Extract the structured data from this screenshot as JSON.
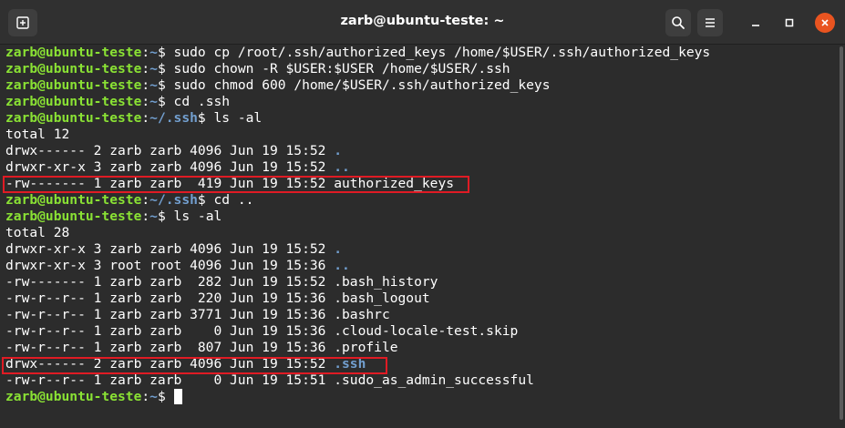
{
  "window": {
    "title": "zarb@ubuntu-teste: ~",
    "icons": {
      "new_tab": "new-tab-icon",
      "search": "search-icon",
      "menu": "hamburger-menu-icon",
      "minimize": "minimize-icon",
      "maximize": "maximize-icon",
      "close": "close-icon"
    }
  },
  "colors": {
    "prompt_user": "#8ae234",
    "prompt_path": "#729fcf",
    "highlight": "#e01b24",
    "close_button": "#e95420"
  },
  "terminal": {
    "lines": [
      {
        "type": "prompt",
        "user": "zarb@ubuntu-teste",
        "sep": ":",
        "path": "~",
        "sym": "$ ",
        "cmd": "sudo cp /root/.ssh/authorized_keys /home/$USER/.ssh/authorized_keys"
      },
      {
        "type": "prompt",
        "user": "zarb@ubuntu-teste",
        "sep": ":",
        "path": "~",
        "sym": "$ ",
        "cmd": "sudo chown -R $USER:$USER /home/$USER/.ssh"
      },
      {
        "type": "prompt",
        "user": "zarb@ubuntu-teste",
        "sep": ":",
        "path": "~",
        "sym": "$ ",
        "cmd": "sudo chmod 600 /home/$USER/.ssh/authorized_keys"
      },
      {
        "type": "prompt",
        "user": "zarb@ubuntu-teste",
        "sep": ":",
        "path": "~",
        "sym": "$ ",
        "cmd": "cd .ssh"
      },
      {
        "type": "prompt",
        "user": "zarb@ubuntu-teste",
        "sep": ":",
        "path": "~/.ssh",
        "sym": "$ ",
        "cmd": "ls -al"
      },
      {
        "type": "text",
        "text": "total 12"
      },
      {
        "type": "entry",
        "meta": "drwx------ 2 zarb zarb 4096 Jun 19 15:52 ",
        "name": ".",
        "dir": true
      },
      {
        "type": "entry",
        "meta": "drwxr-xr-x 3 zarb zarb 4096 Jun 19 15:52 ",
        "name": "..",
        "dir": true
      },
      {
        "type": "entry",
        "meta": "-rw------- 1 zarb zarb  419 Jun 19 15:52 ",
        "name": "authorized_keys",
        "dir": false,
        "highlight": true
      },
      {
        "type": "prompt",
        "user": "zarb@ubuntu-teste",
        "sep": ":",
        "path": "~/.ssh",
        "sym": "$ ",
        "cmd": "cd .."
      },
      {
        "type": "prompt",
        "user": "zarb@ubuntu-teste",
        "sep": ":",
        "path": "~",
        "sym": "$ ",
        "cmd": "ls -al"
      },
      {
        "type": "text",
        "text": "total 28"
      },
      {
        "type": "entry",
        "meta": "drwxr-xr-x 3 zarb zarb 4096 Jun 19 15:52 ",
        "name": ".",
        "dir": true
      },
      {
        "type": "entry",
        "meta": "drwxr-xr-x 3 root root 4096 Jun 19 15:36 ",
        "name": "..",
        "dir": true
      },
      {
        "type": "entry",
        "meta": "-rw------- 1 zarb zarb  282 Jun 19 15:52 ",
        "name": ".bash_history",
        "dir": false
      },
      {
        "type": "entry",
        "meta": "-rw-r--r-- 1 zarb zarb  220 Jun 19 15:36 ",
        "name": ".bash_logout",
        "dir": false
      },
      {
        "type": "entry",
        "meta": "-rw-r--r-- 1 zarb zarb 3771 Jun 19 15:36 ",
        "name": ".bashrc",
        "dir": false
      },
      {
        "type": "entry",
        "meta": "-rw-r--r-- 1 zarb zarb    0 Jun 19 15:36 ",
        "name": ".cloud-locale-test.skip",
        "dir": false
      },
      {
        "type": "entry",
        "meta": "-rw-r--r-- 1 zarb zarb  807 Jun 19 15:36 ",
        "name": ".profile",
        "dir": false
      },
      {
        "type": "entry",
        "meta": "drwx------ 2 zarb zarb 4096 Jun 19 15:52 ",
        "name": ".ssh",
        "dir": true,
        "highlight": true
      },
      {
        "type": "entry",
        "meta": "-rw-r--r-- 1 zarb zarb    0 Jun 19 15:51 ",
        "name": ".sudo_as_admin_successful",
        "dir": false
      },
      {
        "type": "prompt",
        "user": "zarb@ubuntu-teste",
        "sep": ":",
        "path": "~",
        "sym": "$ ",
        "cmd": "",
        "cursor": true
      }
    ]
  }
}
